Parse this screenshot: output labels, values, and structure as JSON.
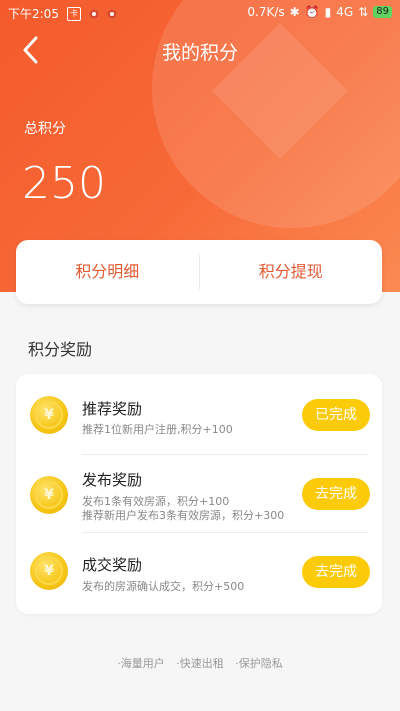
{
  "status_bar": {
    "time": "下午2:05",
    "network_speed": "0.7K/s",
    "network_type": "4G",
    "battery": "89"
  },
  "header": {
    "title": "我的积分",
    "back_icon": "chevron-left-icon"
  },
  "summary": {
    "label": "总积分",
    "value": "250"
  },
  "actions": {
    "detail_label": "积分明细",
    "withdraw_label": "积分提现"
  },
  "rewards": {
    "section_title": "积分奖励",
    "items": [
      {
        "icon": "yuan-coin-icon",
        "name": "推荐奖励",
        "desc_lines": [
          "推荐1位新用户注册,积分+100"
        ],
        "button": "已完成"
      },
      {
        "icon": "yuan-coin-icon",
        "name": "发布奖励",
        "desc_lines": [
          "发布1条有效房源，积分+100",
          "推荐新用户发布3条有效房源，积分+300"
        ],
        "button": "去完成"
      },
      {
        "icon": "yuan-coin-icon",
        "name": "成交奖励",
        "desc_lines": [
          "发布的房源确认成交，积分+500"
        ],
        "button": "去完成"
      }
    ]
  },
  "footer": {
    "items": [
      "·海量用户",
      "·快速出租",
      "·保护隐私"
    ]
  },
  "colors": {
    "header_orange": "#f45a2c",
    "accent_text": "#e05a33",
    "button_yellow": "#fbcb0a"
  }
}
